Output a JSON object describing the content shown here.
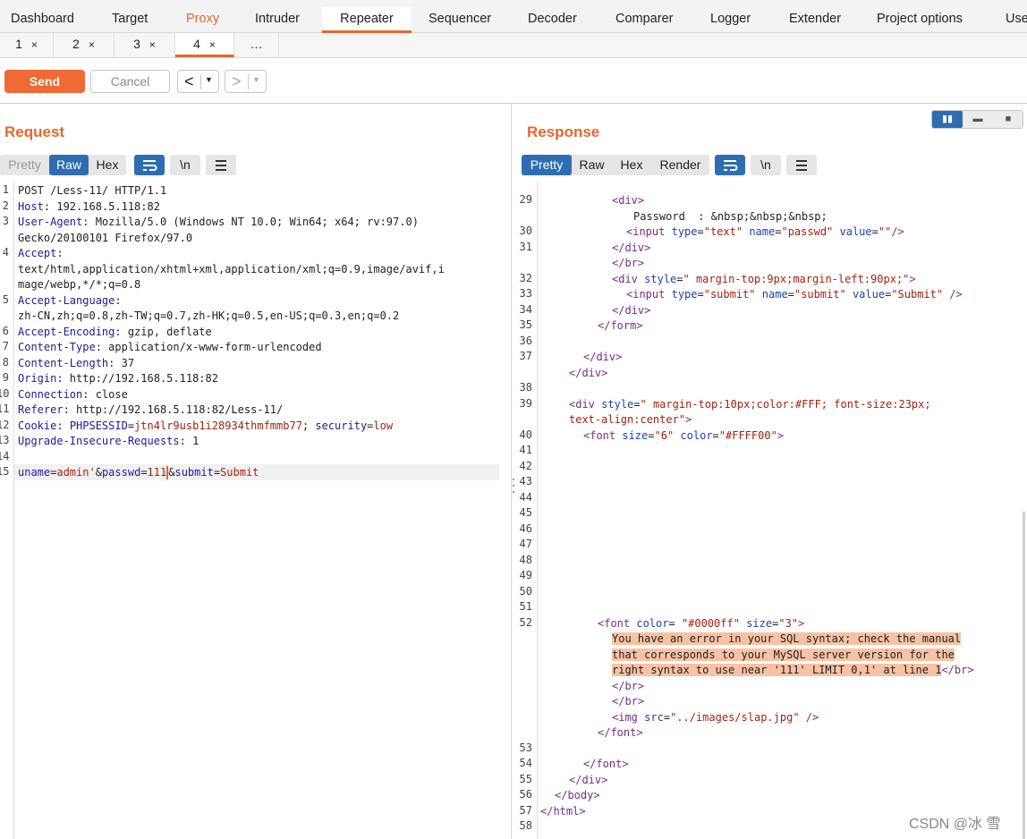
{
  "top_tabs": [
    "Dashboard",
    "Target",
    "Proxy",
    "Intruder",
    "Repeater",
    "Sequencer",
    "Decoder",
    "Comparer",
    "Logger",
    "Extender",
    "Project options",
    "Use"
  ],
  "sub_tabs": [
    {
      "label": "1",
      "close": "×"
    },
    {
      "label": "2",
      "close": "×"
    },
    {
      "label": "3",
      "close": "×"
    },
    {
      "label": "4",
      "close": "×"
    },
    {
      "label": "…",
      "close": ""
    }
  ],
  "toolbar": {
    "send": "Send",
    "cancel": "Cancel",
    "prev": "<",
    "next": ">",
    "dropdown": "▼"
  },
  "request": {
    "title": "Request",
    "formats": [
      "Pretty",
      "Raw",
      "Hex"
    ],
    "active_format": "Raw",
    "newline_icon": "\\n",
    "lines": {
      "l1": "POST /Less-11/ HTTP/1.1",
      "l2k": "Host",
      "l2v": ": 192.168.5.118:82",
      "l3k": "User-Agent",
      "l3v": ": Mozilla/5.0 (Windows NT 10.0; Win64; x64; rv:97.0)",
      "l3c": "Gecko/20100101 Firefox/97.0",
      "l4k": "Accept",
      "l4v": ":",
      "l4c1": "text/html,application/xhtml+xml,application/xml;q=0.9,image/avif,i",
      "l4c2": "mage/webp,*/*;q=0.8",
      "l5k": "Accept-Language",
      "l5v": ":",
      "l5c": "zh-CN,zh;q=0.8,zh-TW;q=0.7,zh-HK;q=0.5,en-US;q=0.3,en;q=0.2",
      "l6k": "Accept-Encoding",
      "l6v": ": gzip, deflate",
      "l7k": "Content-Type",
      "l7v": ": application/x-www-form-urlencoded",
      "l8k": "Content-Length",
      "l8v": ": 37",
      "l9k": "Origin",
      "l9v": ": http://192.168.5.118:82",
      "l10k": "Connection",
      "l10v": ": close",
      "l11k": "Referer",
      "l11v": ": http://192.168.5.118:82/Less-11/",
      "l12k": "Cookie",
      "l12v": ": ",
      "l12p1": "PHPSESSID",
      "l12e1": "=",
      "l12v1": "jtn4lr9usb1i28934thmfmmb77",
      "l12s": "; ",
      "l12p2": "security",
      "l12e2": "=",
      "l12v2": "low",
      "l13k": "Upgrade-Insecure-Requests",
      "l13v": ": 1",
      "l15p1": "uname",
      "l15e1": "=",
      "l15v1": "admin'",
      "l15a1": "&",
      "l15p2": "passwd",
      "l15e2": "=",
      "l15v2": "111",
      "l15a2": "&",
      "l15p3": "submit",
      "l15e3": "=",
      "l15v3": "Submit"
    },
    "line_numbers": [
      "1",
      "2",
      "3",
      "4",
      "5",
      "6",
      "7",
      "8",
      "9",
      "10",
      "11",
      "12",
      "13",
      "14",
      "15"
    ]
  },
  "response": {
    "title": "Response",
    "formats": [
      "Pretty",
      "Raw",
      "Hex",
      "Render"
    ],
    "active_format": "Pretty",
    "newline_icon": "\\n",
    "line_numbers": [
      "29",
      "30",
      "31",
      "32",
      "33",
      "34",
      "35",
      "36",
      "37",
      "38",
      "39",
      "40",
      "41",
      "42",
      "43",
      "44",
      "45",
      "46",
      "47",
      "48",
      "49",
      "50",
      "51",
      "52",
      "53",
      "54",
      "55",
      "56",
      "57",
      "58"
    ],
    "code": {
      "div_open": "<div>",
      "password_text": "Password  : &nbsp;&nbsp;&nbsp;",
      "input_text_tag": "<input",
      "type_attr": "type",
      "text_val": "\"text\"",
      "name_attr": "name",
      "passwd_val": "\"passwd\"",
      "value_attr": "value",
      "empty_val": "\"\"",
      "self_close": "/>",
      "div_close": "</div>",
      "br_close": "</br>",
      "div_style_tag": "<div",
      "style_attr": "style",
      "style_val1": "\" margin-top:9px;margin-left:90px;\"",
      "gt": ">",
      "submit_val": "\"submit\"",
      "submit_value": "\"Submit\"",
      "form_close": "</form>",
      "style_val2": "\" margin-top:10px;color:#FFF; font-size:23px;",
      "style_val2b": "text-align:center\"",
      "font_tag": "<font",
      "size_attr": "size",
      "size6": "\"6\"",
      "color_attr": "color",
      "color_ff": "\"#FFFF00\"",
      "color_blue": "\"#0000ff\"",
      "size3": "\"3\"",
      "err1": "You have an error in your SQL syntax; check the manual",
      "err2": "that corresponds to your MySQL server version for the",
      "err3": "right syntax to use near '111' LIMIT 0,1' at line 1",
      "img_tag": "<img",
      "src_attr": "src",
      "src_val": "\"../images/slap.jpg\"",
      "font_close": "</font>",
      "body_close": "</body>",
      "html_close": "</html>"
    },
    "view_toggles": [
      "▮▮",
      "▬",
      "■"
    ]
  },
  "watermark": "CSDN @冰 雪",
  "colors": {
    "accent": "#e8672c",
    "blue": "#2f6db3",
    "highlight": "#f8c2a3"
  }
}
